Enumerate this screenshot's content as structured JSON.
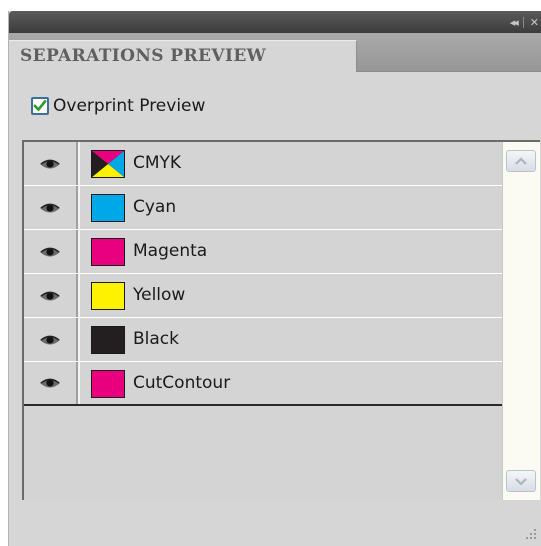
{
  "panel": {
    "title_controls": {
      "collapse_icon": "double-chevron-left-icon",
      "close_icon": "close-icon",
      "collapse_glyph": "◂◂",
      "close_glyph": "✕"
    },
    "tab_label": "SEPARATIONS PREVIEW",
    "overprint": {
      "label": "Overprint Preview",
      "checked": true
    }
  },
  "separations": [
    {
      "label": "CMYK",
      "swatch": "cmyk-composite",
      "visible": true
    },
    {
      "label": "Cyan",
      "swatch": "#00a8e8",
      "visible": true
    },
    {
      "label": "Magenta",
      "swatch": "#e8007e",
      "visible": true
    },
    {
      "label": "Yellow",
      "swatch": "#fff200",
      "visible": true
    },
    {
      "label": "Black",
      "swatch": "#231f20",
      "visible": true
    },
    {
      "label": "CutContour",
      "swatch": "#e8007e",
      "visible": true
    }
  ],
  "colors": {
    "title_bar": "#474747",
    "panel_bg": "#d6d6d6",
    "check_color": "#2e9a2e"
  }
}
